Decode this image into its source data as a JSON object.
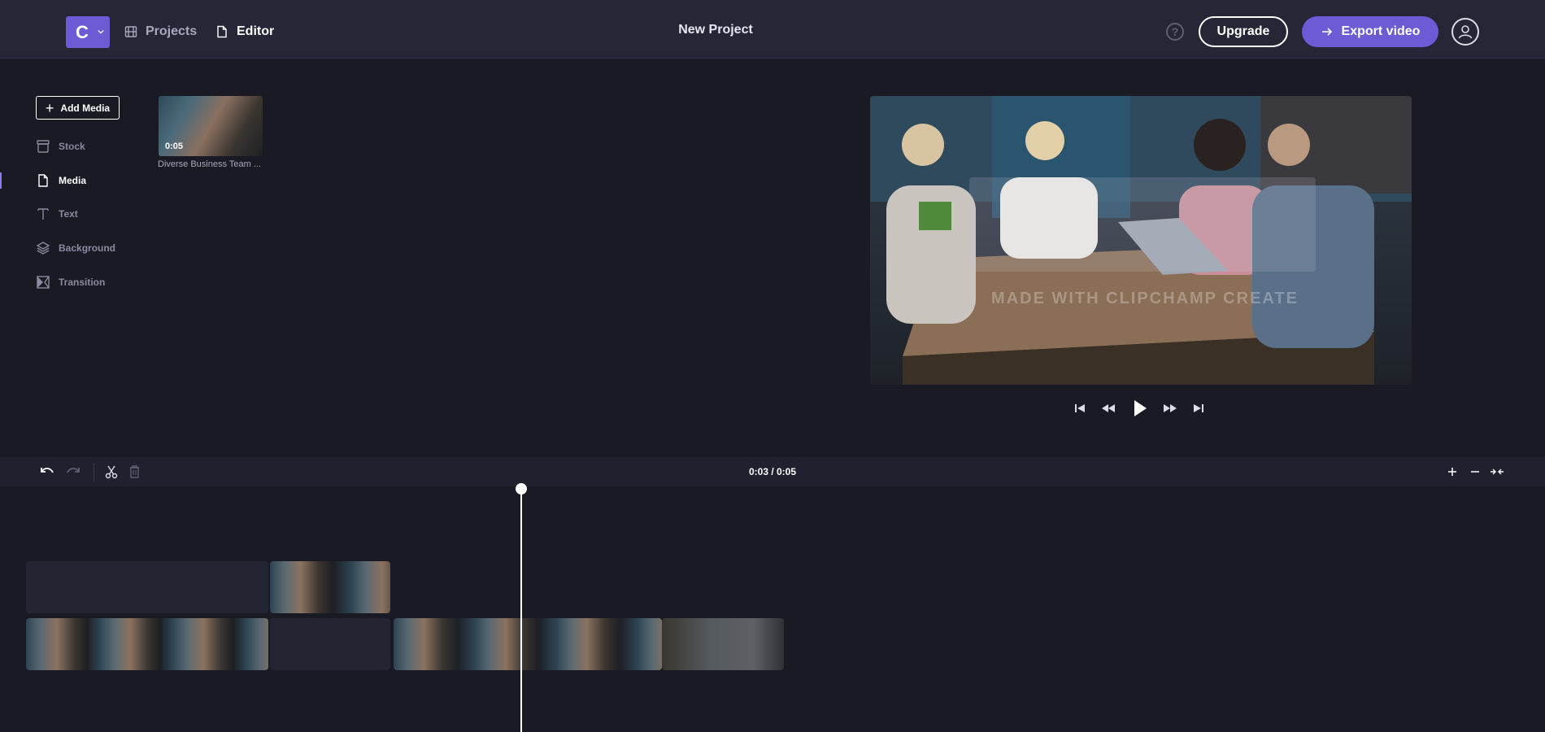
{
  "header": {
    "logo_letter": "C",
    "nav": {
      "projects": "Projects",
      "editor": "Editor"
    },
    "project_title": "New Project",
    "help_symbol": "?",
    "upgrade_label": "Upgrade",
    "export_label": "Export video"
  },
  "sidebar": {
    "add_media_label": "Add Media",
    "items": [
      {
        "label": "Stock",
        "icon": "stock-icon"
      },
      {
        "label": "Media",
        "icon": "file-icon",
        "active": true
      },
      {
        "label": "Text",
        "icon": "text-icon"
      },
      {
        "label": "Background",
        "icon": "layers-icon"
      },
      {
        "label": "Transition",
        "icon": "transition-icon"
      }
    ]
  },
  "media": {
    "thumb_duration": "0:05",
    "caption": "Diverse Business Team ..."
  },
  "preview": {
    "watermark_text": "MADE WITH CLIPCHAMP CREATE"
  },
  "timeline": {
    "time_readout": "0:03 / 0:05"
  },
  "colors": {
    "accent": "#6b5cd6",
    "background": "#1a1a25",
    "header": "#262637"
  }
}
